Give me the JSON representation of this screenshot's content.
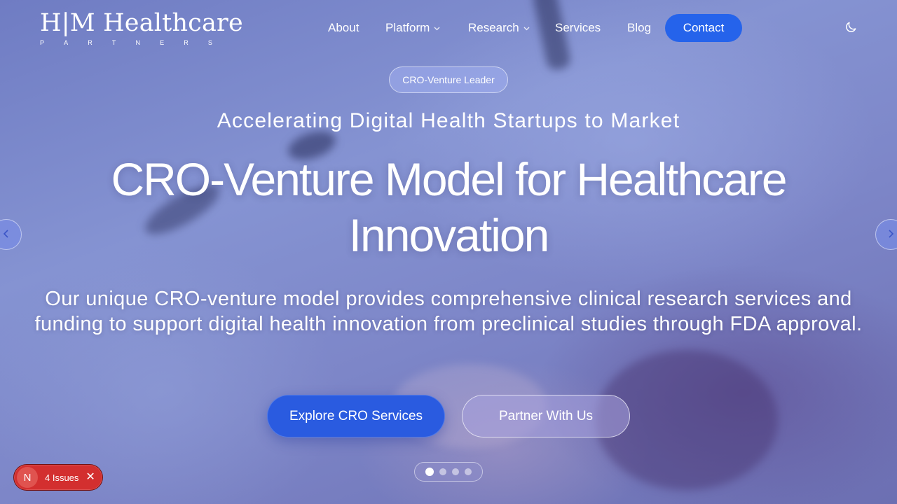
{
  "header": {
    "logo_main": "H|M Healthcare",
    "logo_sub_letters": [
      "P",
      "A",
      "R",
      "T",
      "N",
      "E",
      "R",
      "S"
    ],
    "nav": {
      "about": "About",
      "platform": "Platform",
      "research": "Research",
      "services": "Services",
      "blog": "Blog"
    },
    "contact_label": "Contact",
    "theme_icon": "moon-icon"
  },
  "hero": {
    "badge": "CRO-Venture Leader",
    "subtitle": "Accelerating Digital Health Startups to Market",
    "title": "CRO-Venture Model for Healthcare Innovation",
    "description": "Our unique CRO-venture model provides comprehensive clinical research services and funding to support digital health innovation from preclinical studies through FDA approval.",
    "primary_button": "Explore CRO Services",
    "secondary_button": "Partner With Us",
    "carousel": {
      "slide_count": 4,
      "active_slide": 1
    }
  },
  "dev_overlay": {
    "logo_letter": "N",
    "issues_label": "4 Issues",
    "close_glyph": "✕"
  },
  "colors": {
    "accent": "#2563eb",
    "issues_bg": "#d32f2f",
    "hero_tint": "#7b86c9"
  }
}
